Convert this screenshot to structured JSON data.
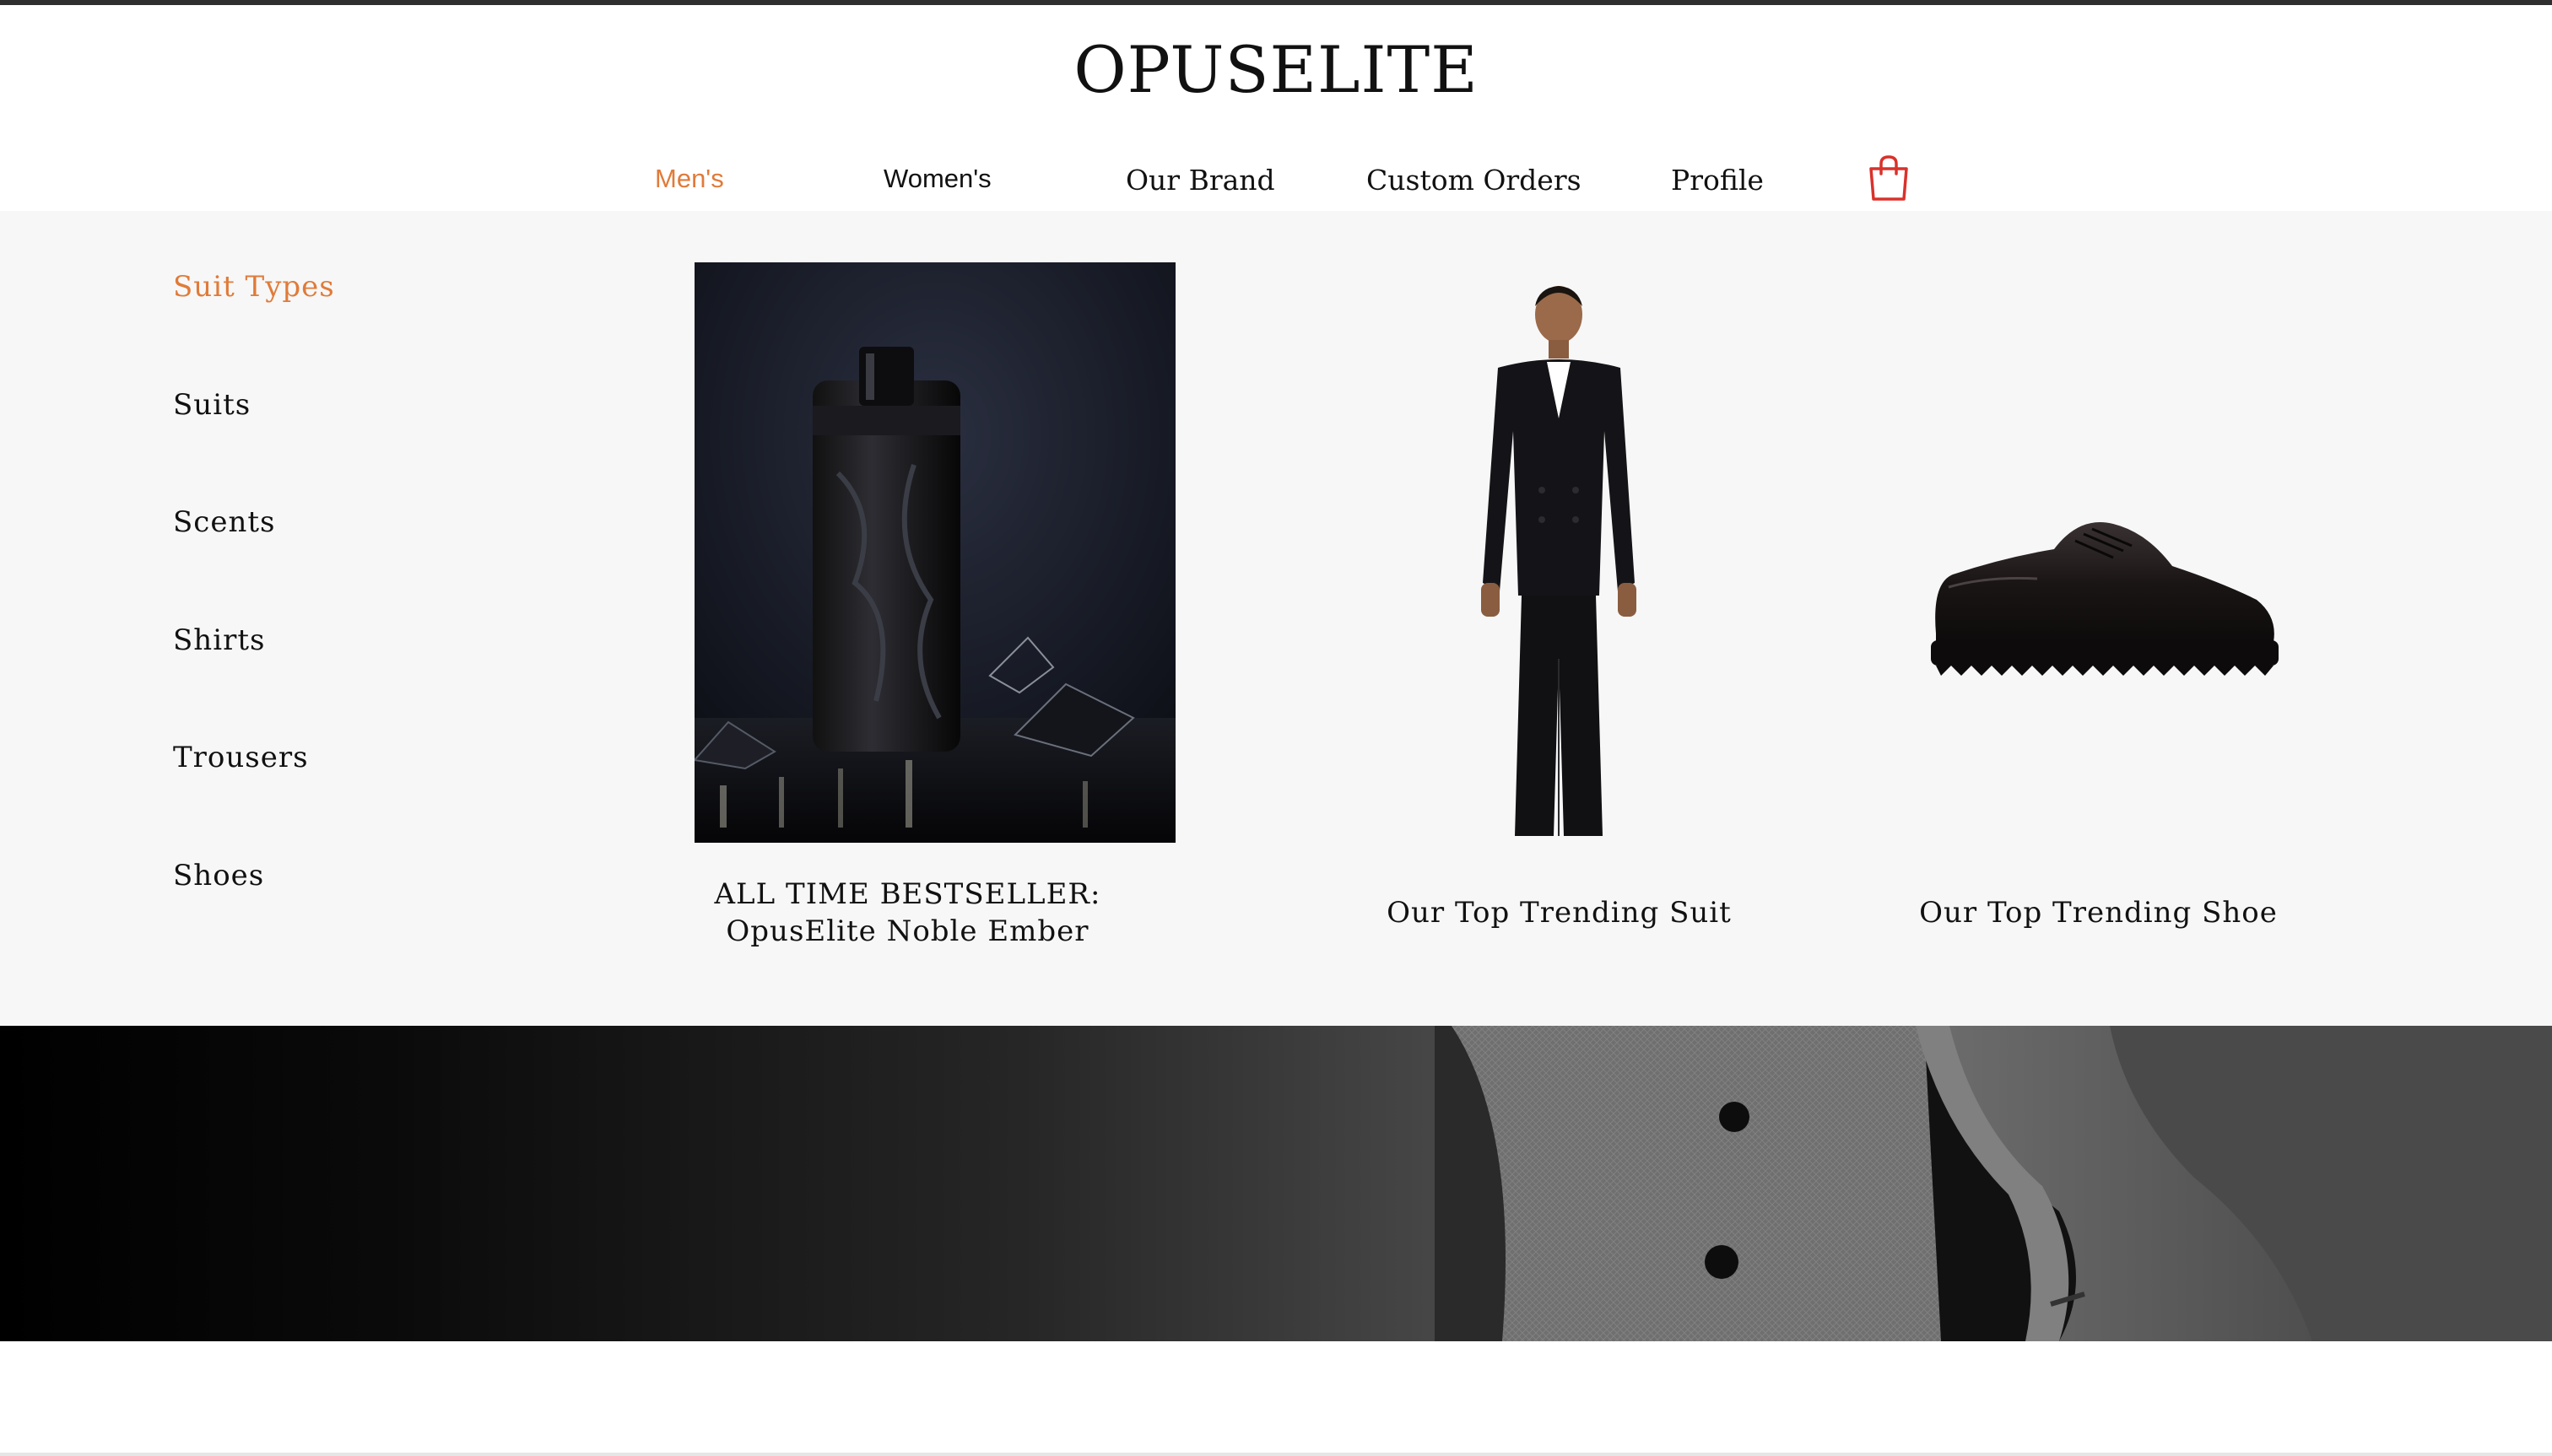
{
  "brand": {
    "name": "OPUSELITE"
  },
  "nav": {
    "items": [
      {
        "label": "Men's",
        "active": true
      },
      {
        "label": "Women's"
      },
      {
        "label": "Our Brand"
      },
      {
        "label": "Custom Orders"
      },
      {
        "label": "Profile"
      }
    ],
    "cart_icon": "shopping-bag-icon"
  },
  "menu": {
    "sidebar": [
      {
        "label": "Suit Types",
        "active": true
      },
      {
        "label": "Suits"
      },
      {
        "label": "Scents"
      },
      {
        "label": "Shirts"
      },
      {
        "label": "Trousers"
      },
      {
        "label": "Shoes"
      }
    ],
    "cards": [
      {
        "caption_line1": "ALL TIME BESTSELLER:",
        "caption_line2": "OpusElite Noble Ember",
        "image": "perfume-bottle-image"
      },
      {
        "caption": "Our Top Trending Suit",
        "image": "man-in-suit-image"
      },
      {
        "caption": "Our Top Trending Shoe",
        "image": "derby-shoe-image"
      }
    ]
  },
  "colors": {
    "accent": "#e07b39",
    "cart_icon": "#d9322b",
    "menu_bg": "#f7f7f7"
  }
}
